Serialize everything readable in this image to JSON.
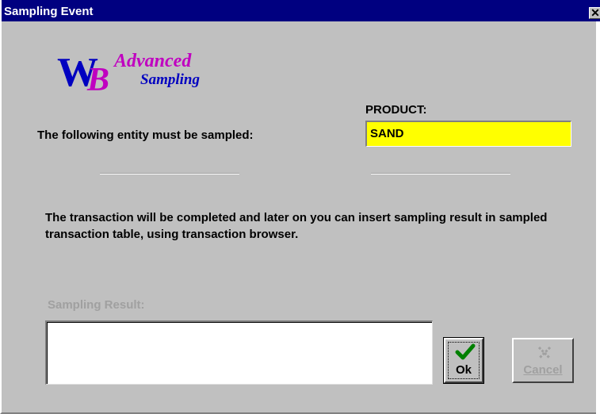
{
  "window": {
    "title": "Sampling Event",
    "close_symbol": "✕"
  },
  "logo": {
    "mark": "WB",
    "line1": "Advanced",
    "line2": "Sampling"
  },
  "product": {
    "label": "PRODUCT:",
    "value": "SAND"
  },
  "entity_label": "The following entity must be sampled:",
  "info_text": "The transaction will be completed and later on you can insert sampling result in sampled transaction table, using transaction browser.",
  "sampling_result": {
    "label": "Sampling Result:",
    "value": ""
  },
  "buttons": {
    "ok": {
      "label": "Ok",
      "icon": "checkmark-icon"
    },
    "cancel": {
      "label": "Cancel",
      "icon": "cancel-x-icon"
    }
  },
  "colors": {
    "titlebar": "#000080",
    "product_highlight": "#ffff00",
    "ok_check": "#008000",
    "logo_blue": "#0000c0",
    "logo_purple": "#c000c0"
  }
}
